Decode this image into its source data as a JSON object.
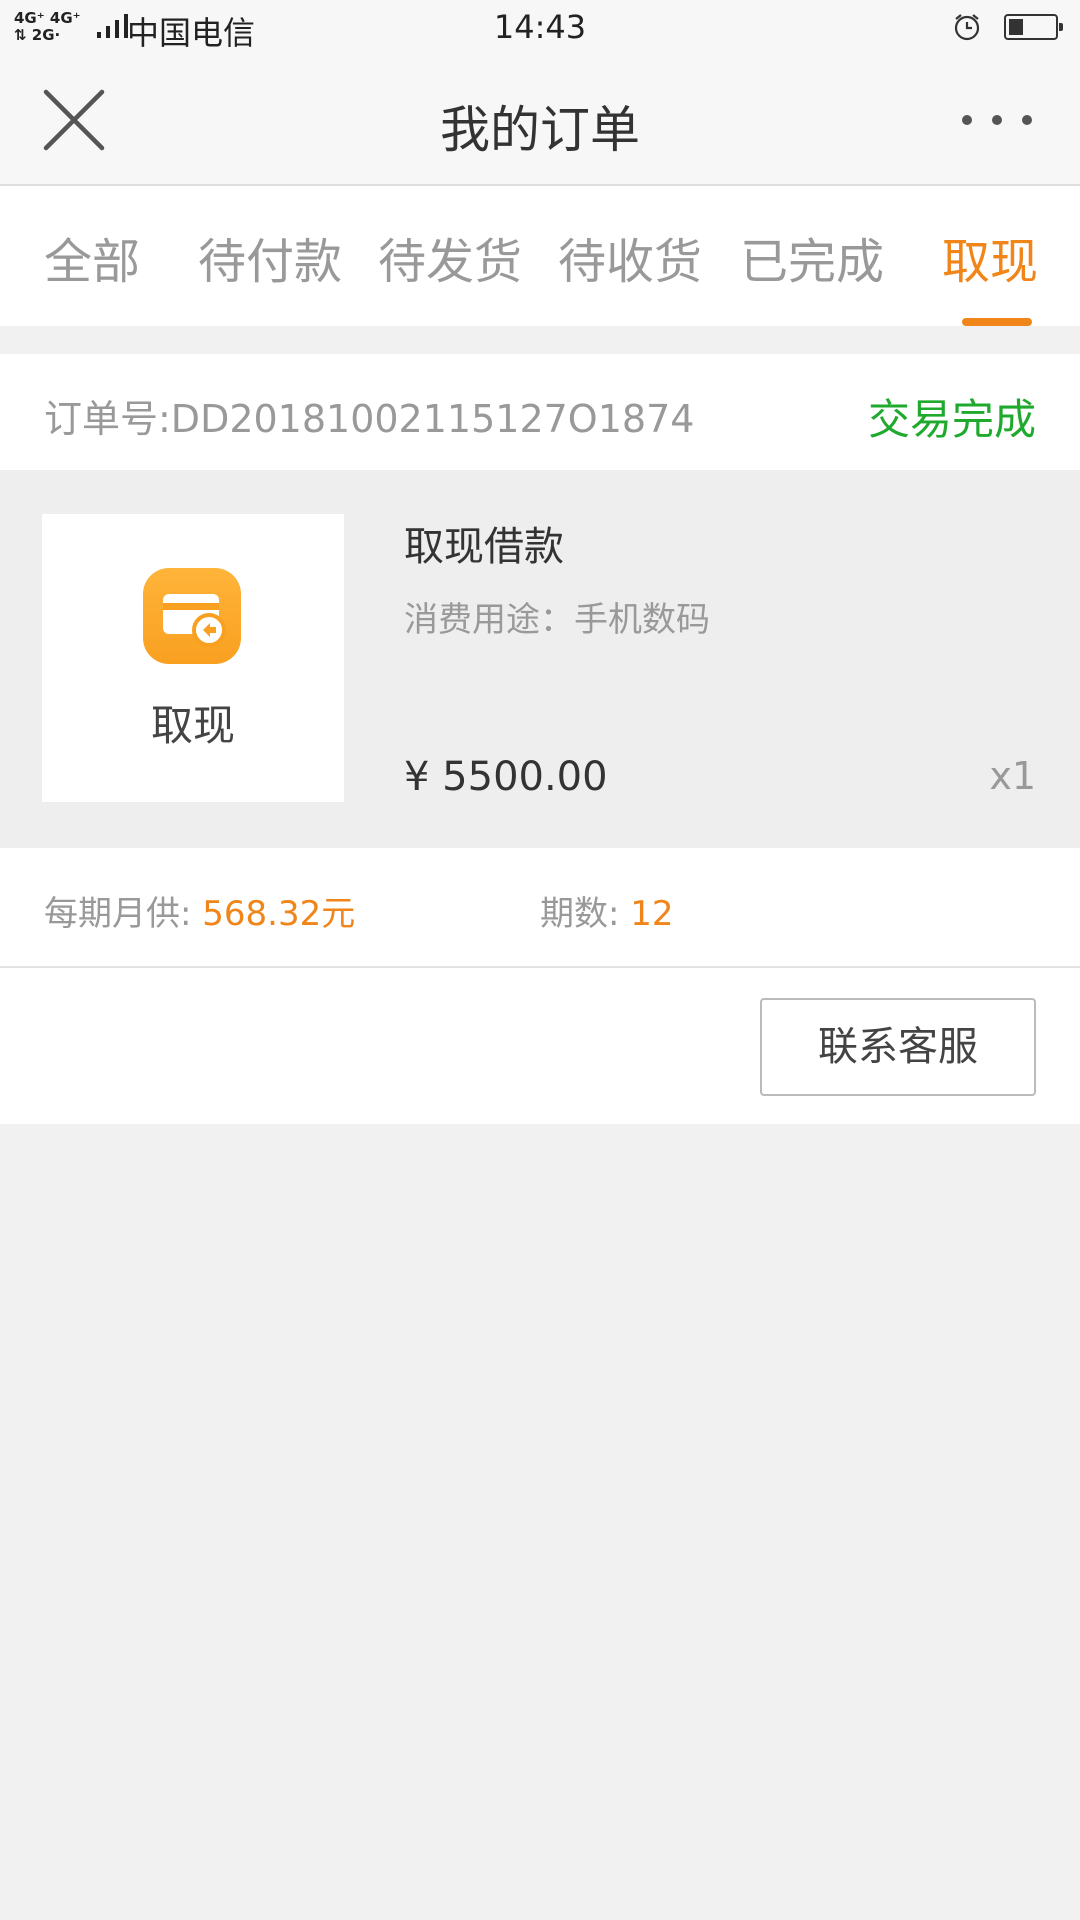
{
  "status_bar": {
    "signal": "4G⁺ 4G⁺\n⇅ 2G",
    "carrier": "中国电信",
    "time": "14:43",
    "alarm_icon": "alarm-clock-icon",
    "battery_icon": "battery-low-icon"
  },
  "nav": {
    "title": "我的订单",
    "close_icon": "close-icon",
    "more_icon": "more-dots-icon"
  },
  "tabs": [
    {
      "label": "全部",
      "active": false
    },
    {
      "label": "待付款",
      "active": false
    },
    {
      "label": "待发货",
      "active": false
    },
    {
      "label": "待收货",
      "active": false
    },
    {
      "label": "已完成",
      "active": false
    },
    {
      "label": "取现",
      "active": true
    }
  ],
  "order": {
    "number_label": "订单号:DD20181002115127O1874",
    "status": "交易完成",
    "thumb_icon": "cash-card-icon",
    "thumb_label": "取现",
    "product_title": "取现借款",
    "usage": "消费用途：手机数码",
    "price": "¥ 5500.00",
    "quantity": "x1",
    "monthly_label": "每期月供: ",
    "monthly_value": "568.32元",
    "periods_label": "期数: ",
    "periods_value": "12",
    "service_button": "联系客服"
  },
  "colors": {
    "accent": "#f08519",
    "success": "#1faa2e",
    "background": "#f1f1f1"
  }
}
